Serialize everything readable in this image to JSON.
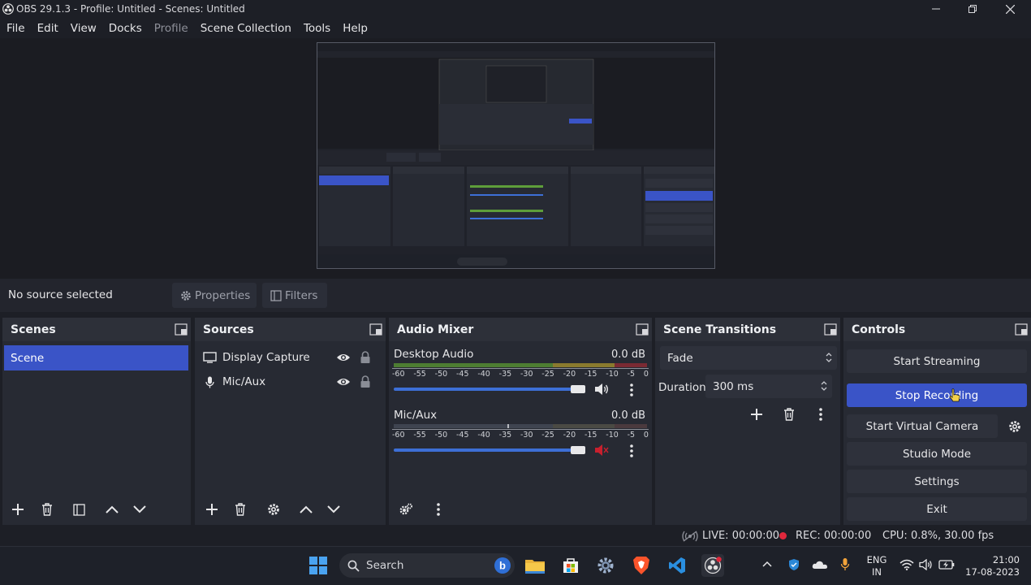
{
  "window": {
    "title": "OBS 29.1.3 - Profile: Untitled - Scenes: Untitled"
  },
  "menu": [
    "File",
    "Edit",
    "View",
    "Docks",
    "Profile",
    "Scene Collection",
    "Tools",
    "Help"
  ],
  "properties_bar": {
    "no_source": "No source selected",
    "properties_label": "Properties",
    "filters_label": "Filters"
  },
  "scenes": {
    "title": "Scenes",
    "items": [
      "Scene"
    ]
  },
  "sources": {
    "title": "Sources",
    "items": [
      {
        "name": "Display Capture",
        "icon": "monitor-icon"
      },
      {
        "name": "Mic/Aux",
        "icon": "microphone-icon"
      }
    ]
  },
  "mixer": {
    "title": "Audio Mixer",
    "channels": [
      {
        "name": "Desktop Audio",
        "db": "0.0 dB",
        "volume": 1.0,
        "muted": false
      },
      {
        "name": "Mic/Aux",
        "db": "0.0 dB",
        "volume": 1.0,
        "muted": true
      }
    ],
    "ticks": [
      "-60",
      "-55",
      "-50",
      "-45",
      "-40",
      "-35",
      "-30",
      "-25",
      "-20",
      "-15",
      "-10",
      "-5",
      "0"
    ]
  },
  "transitions": {
    "title": "Scene Transitions",
    "selected": "Fade",
    "duration_label": "Duration",
    "duration_value": "300 ms"
  },
  "controls": {
    "title": "Controls",
    "start_streaming": "Start Streaming",
    "stop_recording": "Stop Recording",
    "start_virtual_camera": "Start Virtual Camera",
    "studio_mode": "Studio Mode",
    "settings": "Settings",
    "exit": "Exit"
  },
  "status": {
    "live": "LIVE: 00:00:00",
    "rec": "REC: 00:00:00",
    "cpu": "CPU: 0.8%, 30.00 fps"
  },
  "taskbar": {
    "search_label": "Search",
    "lang_top": "ENG",
    "lang_bottom": "IN",
    "time": "21:00",
    "date": "17-08-2023"
  },
  "colors": {
    "accent": "#3a54c7",
    "rec_dot": "#e0283c",
    "slider": "#3d6fd6"
  }
}
